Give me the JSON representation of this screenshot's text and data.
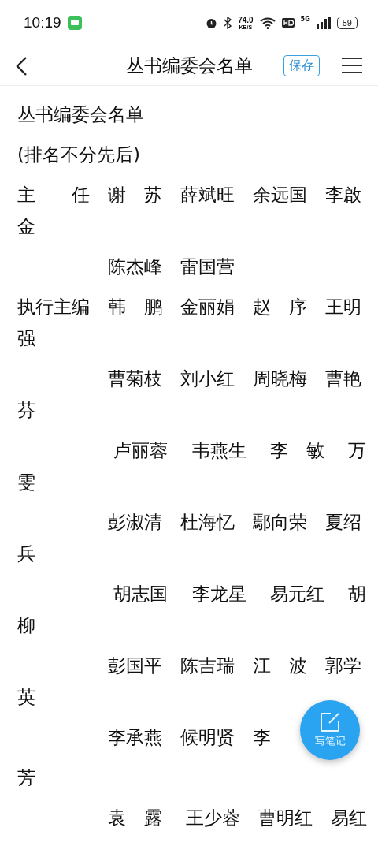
{
  "status_bar": {
    "time": "10:19",
    "speed": "74.0",
    "speed_unit": "KB/S",
    "network": "5G",
    "battery": "59"
  },
  "header": {
    "title": "丛书编委会名单",
    "save_button": "保存"
  },
  "content": {
    "title": "丛书编委会名单",
    "subtitle": "(排名不分先后)",
    "lines": [
      "主　　任　谢　苏　薛斌旺　余远国　李啟金",
      "　　　　　陈杰峰　雷国营",
      "执行主编　韩　鹏　金丽娟　赵　序　王明强",
      "　　　　　曹菊枝　刘小红　周晓梅　曹艳芬",
      "　　　　　 卢丽蓉　 韦燕生　 李　敏　 万雯",
      "　　　　　彭淑清　杜海忆　鄢向荣　夏绍兵",
      "　　　　　 胡志国　 李龙星　 易元红　 胡柳",
      "　　　　　彭国平　陈吉瑞　江　波　郭学英",
      "　　　　　李承燕　候明贤　李",
      "芳",
      "　　　　　袁　露　 王少蓉　曹明红　易红"
    ]
  },
  "fab": {
    "label": "写笔记"
  }
}
